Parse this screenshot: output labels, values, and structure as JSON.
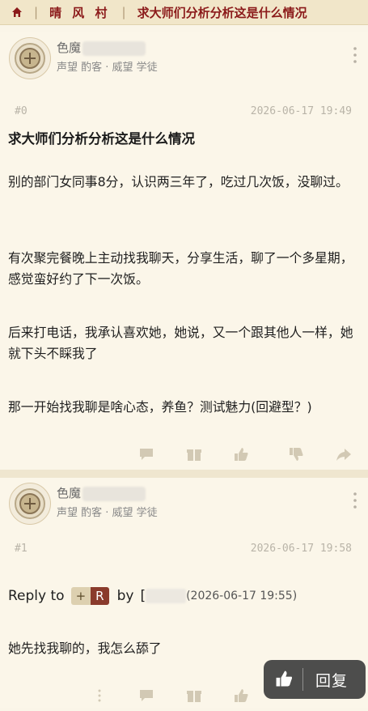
{
  "breadcrumb": {
    "home_icon": "home-icon",
    "site": "晴 风 村",
    "thread_title": "求大师们分析分析这是什么情况"
  },
  "posts": [
    {
      "username": "色魔",
      "rank": "声望 酌客 · 威望 学徒",
      "floor": "#0",
      "time": "2026-06-17 19:49",
      "title": "求大师们分析分析这是什么情况",
      "paragraphs": [
        "别的部门女同事8分，认识两三年了，吃过几次饭，没聊过。",
        "有次聚完餐晚上主动找我聊天，分享生活，聊了一个多星期，感觉蛮好约了下一次饭。",
        "后来打电话，我承认喜欢她，她说，又一个跟其他人一样，她就下头不睬我了",
        "那一开始找我聊是啥心态，养鱼？测试魅力(回避型？)"
      ]
    },
    {
      "username": "色魔",
      "rank": "声望 酌客 · 威望 学徒",
      "floor": "#1",
      "time": "2026-06-17 19:58",
      "reply_prefix": "Reply to",
      "tag_plus": "+",
      "tag_r": "R",
      "reply_by": "by",
      "reply_bracket_open": "[",
      "reply_time": "(2026-06-17 19:55)",
      "content": "她先找我聊的，我怎么舔了"
    }
  ],
  "float_bar": {
    "like_icon": "thumbs-up-icon",
    "reply_label": "回复"
  },
  "colors": {
    "accent": "#8b1a1a",
    "background": "#faf5e8",
    "tag_r": "#8a3b2c"
  }
}
